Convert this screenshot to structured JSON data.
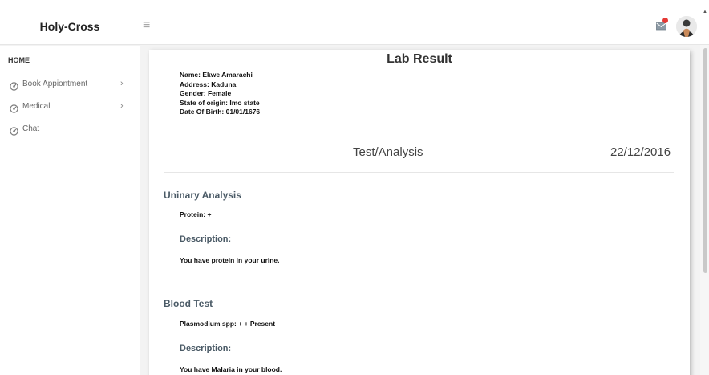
{
  "app": {
    "brand": "Holy-Cross",
    "menu_glyph": "≡"
  },
  "sidebar": {
    "heading": "HOME",
    "items": [
      {
        "label": "Book Appiontment",
        "has_submenu": true,
        "chevron": "›"
      },
      {
        "label": "Medical",
        "has_submenu": true,
        "chevron": "›"
      },
      {
        "label": "Chat",
        "has_submenu": false
      }
    ]
  },
  "header": {
    "mail_icon": "mail-icon",
    "notification_dot_color": "#e53935"
  },
  "report": {
    "title": "Lab Result",
    "patient": {
      "name": "Name: Ekwe Amarachi",
      "address": "Address: Kaduna",
      "gender": "Gender: Female",
      "state": "State of origin: Imo state",
      "dob": "Date Of Birth: 01/01/1676"
    },
    "subheading": "Test/Analysis",
    "date": "22/12/2016",
    "sections": [
      {
        "title": "Uninary Analysis",
        "result": "Protein:  +",
        "description_heading": "Description:",
        "description": "You have protein in your urine."
      },
      {
        "title": "Blood Test",
        "result": "Plasmodium spp:  + + Present",
        "description_heading": "Description:",
        "description": "You have Malaria in your blood."
      }
    ]
  },
  "colors": {
    "section_heading": "#4a5a66",
    "accent_dot": "#e53935"
  }
}
